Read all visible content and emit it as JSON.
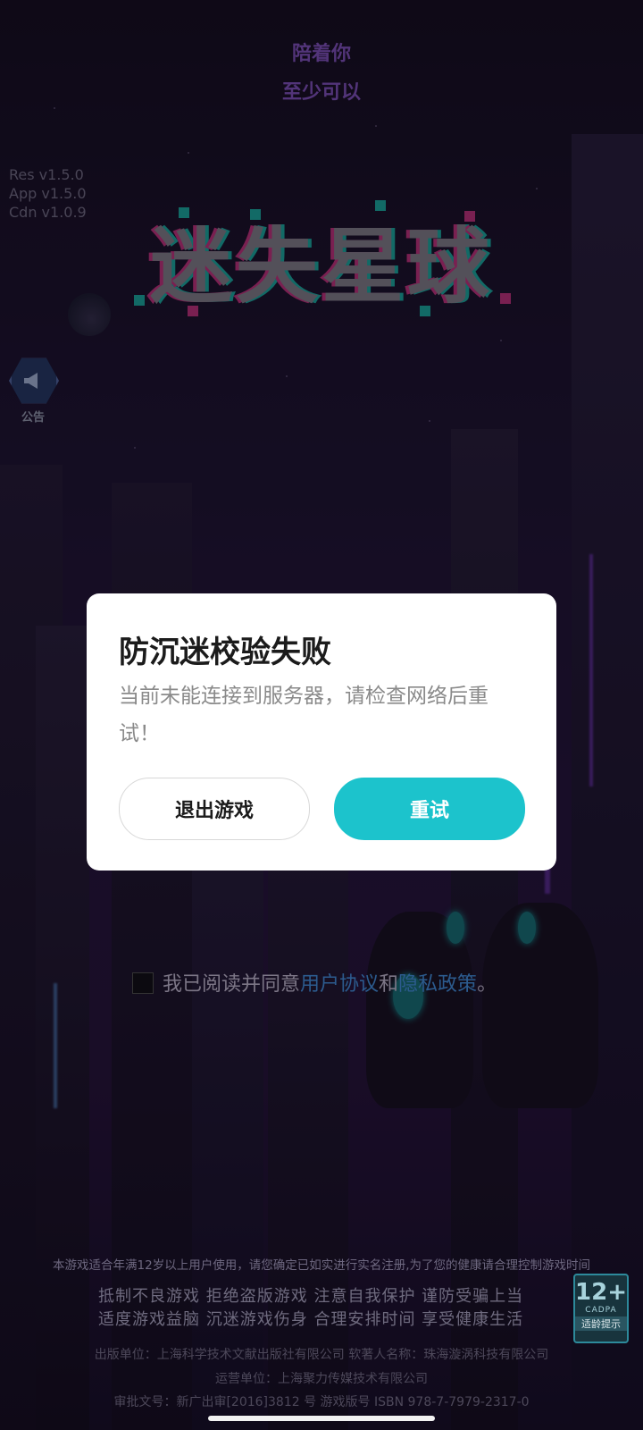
{
  "header": {
    "line1": "陪着你",
    "line2": "至少可以"
  },
  "versions": [
    "Res v1.5.0",
    "App v1.5.0",
    "Cdn v1.0.9"
  ],
  "logo": {
    "text": "迷失星球"
  },
  "notice_button": {
    "label": "公告"
  },
  "dialog": {
    "title": "防沉迷校验失败",
    "message": "当前未能连接到服务器，请检查网络后重试！",
    "exit_label": "退出游戏",
    "retry_label": "重试"
  },
  "agreement": {
    "prefix": "我已阅读并同意",
    "user_agreement": "用户协议",
    "and": "和",
    "privacy_policy": "隐私政策",
    "suffix": "。"
  },
  "footer": {
    "age_notice": "本游戏适合年满12岁以上用户使用，请您确定已如实进行实名注册,为了您的健康请合理控制游戏时间",
    "slogan_line1": "抵制不良游戏 拒绝盗版游戏 注意自我保护 谨防受骗上当",
    "slogan_line2": "适度游戏益脑 沉迷游戏伤身 合理安排时间 享受健康生活",
    "publisher": "出版单位：上海科学技术文献出版社有限公司 软著人名称：珠海漩涡科技有限公司",
    "operator": "运营单位：上海聚力传媒技术有限公司",
    "approval": "审批文号：新广出审[2016]3812 号       游戏版号 ISBN 978-7-7979-2317-0"
  },
  "age_badge": {
    "rating": "12+",
    "org": "CADPA",
    "tip": "适龄提示"
  },
  "colors": {
    "retry_button": "#1cc3cc",
    "header_text": "#8d5bd0",
    "link": "#2c5b8e"
  }
}
